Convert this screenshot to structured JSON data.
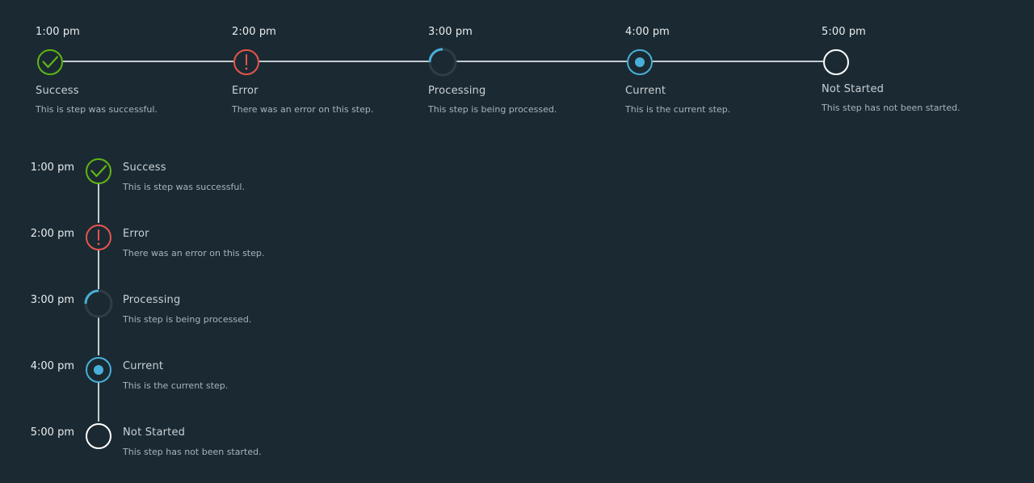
{
  "colors": {
    "background": "#1b2a32",
    "success": "#60b515",
    "error": "#e6544c",
    "processing": "#49afd9",
    "current": "#49afd9",
    "not_started": "#ffffff",
    "connector": "#c4cbd0"
  },
  "steps": [
    {
      "time": "1:00 pm",
      "title": "Success",
      "description": "This is step was successful.",
      "state": "success",
      "icon": "check-circle-icon"
    },
    {
      "time": "2:00 pm",
      "title": "Error",
      "description": "There was an error on this step.",
      "state": "error",
      "icon": "exclamation-circle-icon"
    },
    {
      "time": "3:00 pm",
      "title": "Processing",
      "description": "This step is being processed.",
      "state": "processing",
      "icon": "spinner-icon"
    },
    {
      "time": "4:00 pm",
      "title": "Current",
      "description": "This is the current step.",
      "state": "current",
      "icon": "dot-circle-icon"
    },
    {
      "time": "5:00 pm",
      "title": "Not Started",
      "description": "This step has not been started.",
      "state": "not-started",
      "icon": "circle-icon"
    }
  ]
}
